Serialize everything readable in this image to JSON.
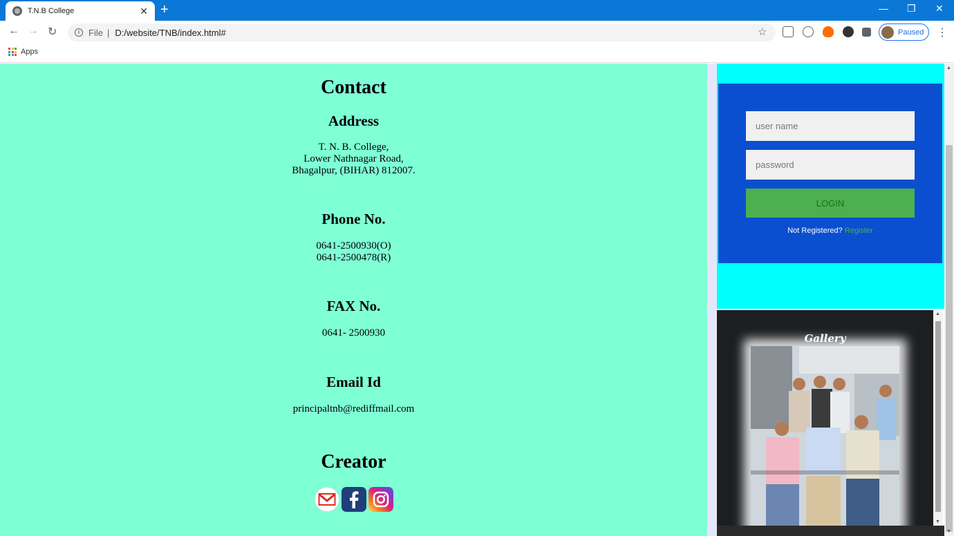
{
  "browser": {
    "tab_title": "T.N.B College",
    "tab_close": "✕",
    "new_tab": "+",
    "url_scheme": "File",
    "url_separator": "|",
    "url": "D:/website/TNB/index.html#",
    "profile_status": "Paused",
    "bookmarks_apps": "Apps"
  },
  "contact": {
    "heading": "Contact",
    "address_heading": "Address",
    "address_lines": [
      "T. N. B. College,",
      "Lower Nathnagar Road,",
      "Bhagalpur, (BIHAR) 812007."
    ],
    "phone_heading": "Phone No.",
    "phone_lines": [
      "0641-2500930(O)",
      "0641-2500478(R)"
    ],
    "fax_heading": "FAX No.",
    "fax": "0641- 2500930",
    "email_heading": "Email Id",
    "email": "principaltnb@rediffmail.com",
    "creator_heading": "Creator"
  },
  "social_icons": [
    "gmail-icon",
    "facebook-icon",
    "instagram-icon"
  ],
  "login": {
    "username_placeholder": "user name",
    "password_placeholder": "password",
    "button_label": "LOGIN",
    "not_registered": "Not Registered?",
    "register_link": "Register"
  },
  "gallery": {
    "title": "Gallery"
  },
  "colors": {
    "main_bg": "#7fffd4",
    "sidebar_bg": "#00ffff",
    "login_bg": "#0a4fd0",
    "login_button": "#4caf50",
    "chrome_bar": "#0b78d7"
  }
}
